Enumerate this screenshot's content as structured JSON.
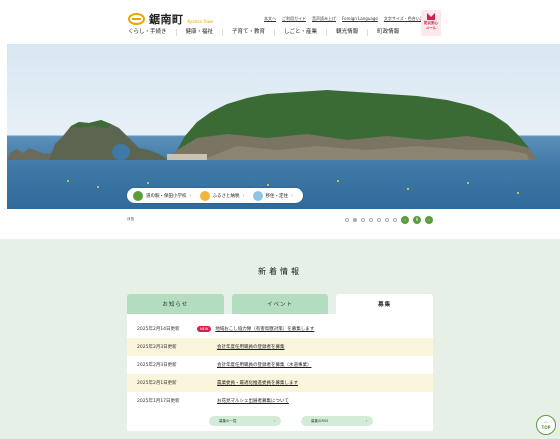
{
  "header": {
    "town_name": "鋸南町",
    "town_sub": "Kyonan Town",
    "utility_links": [
      "本文へ",
      "ご利用ガイド",
      "音声読み上げ",
      "Foreign Language",
      "文字サイズ・色合い変更"
    ],
    "mail_button": [
      "防災安心",
      "メール"
    ],
    "nav": [
      "くらし・手続き",
      "健康・福祉",
      "子育て・教育",
      "しごと・産業",
      "観光情報",
      "町政情報"
    ]
  },
  "hero": {
    "quick_links": [
      "道の駅・保田小学校",
      "ふるさと納税",
      "移住・定住"
    ],
    "caption": "浮島",
    "slide_count": 7,
    "active_slide": 1,
    "controls": [
      "‹",
      "II",
      "›"
    ]
  },
  "news": {
    "title": "新着情報",
    "tabs": [
      "お知らせ",
      "イベント",
      "募集"
    ],
    "active_tab": 2,
    "new_badge": "NEW",
    "items": [
      {
        "date": "2025年2月14日更新",
        "new": true,
        "text": "地域おこし協力隊（有害鳥獣対策）を募集します"
      },
      {
        "date": "2025年2月3日更新",
        "new": false,
        "text": "会計年度任用職員の登録者を募集"
      },
      {
        "date": "2025年2月3日更新",
        "new": false,
        "text": "会計年度任用職員の登録者を募集（水道事業）"
      },
      {
        "date": "2025年2月1日更新",
        "new": false,
        "text": "農業委員・最適化推進委員を募集します"
      },
      {
        "date": "2025年1月17日更新",
        "new": false,
        "text": "お花見マルシェ出展者募集について"
      }
    ],
    "buttons": [
      "募集の一覧",
      "募集のRSS"
    ]
  },
  "top_button": "TOP",
  "colors": {
    "accent_green": "#5c9c3c",
    "tab_green": "#b4dcc0",
    "badge_red": "#d6204b",
    "section_bg": "#e6f0e6"
  }
}
